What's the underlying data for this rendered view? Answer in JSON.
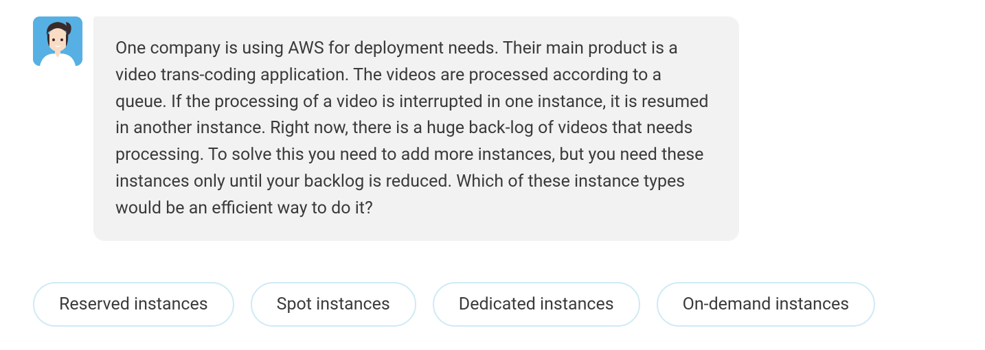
{
  "message": {
    "text": "One company is using AWS for deployment needs. Their main product is a video trans-coding application. The videos are processed according to a queue. If the processing of a video is interrupted in one instance, it is resumed in another instance. Right now, there is a huge back-log of videos that needs processing. To solve this you need to add more instances, but you need these instances only until your backlog is reduced. Which of these instance types would be an efficient way to do it?"
  },
  "options": [
    {
      "label": "Reserved instances"
    },
    {
      "label": "Spot instances"
    },
    {
      "label": "Dedicated instances"
    },
    {
      "label": "On-demand instances"
    }
  ]
}
